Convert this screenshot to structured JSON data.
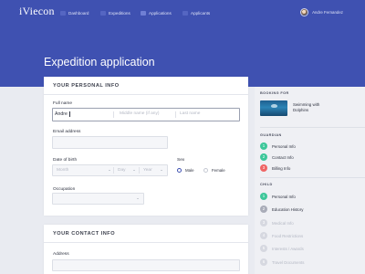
{
  "app": {
    "logo": "iViecon"
  },
  "nav": {
    "items": [
      {
        "label": "Dashboard"
      },
      {
        "label": "Expeditions"
      },
      {
        "label": "Applications"
      },
      {
        "label": "Applicants"
      }
    ],
    "user_name": "Andre Fernandez"
  },
  "page": {
    "title": "Expedition application"
  },
  "personal": {
    "section_title": "YOUR PERSONAL INFO",
    "fullname_label": "Full name",
    "first_value": "Andre",
    "middle_placeholder": "Middle name (if any)",
    "last_placeholder": "Last name",
    "email_label": "Email address",
    "dob_label": "Date of birth",
    "month_placeholder": "Month",
    "day_placeholder": "Day",
    "year_placeholder": "Year",
    "sex_label": "Sex",
    "male_label": "Male",
    "female_label": "Female",
    "sex_selected": "Male",
    "occupation_label": "Occupation"
  },
  "contact": {
    "section_title": "YOUR CONTACT INFO",
    "address_label": "Address"
  },
  "sidebar": {
    "booking_heading": "BOOKING FOR",
    "booking_title": "Swimming with Dolphins",
    "guardian_heading": "GUARDIAN",
    "guardian_steps": [
      {
        "num": "1",
        "label": "Personal Info",
        "status": "done"
      },
      {
        "num": "2",
        "label": "Contact Info",
        "status": "done"
      },
      {
        "num": "3",
        "label": "Billing Info",
        "status": "error"
      }
    ],
    "child_heading": "CHILD",
    "child_steps": [
      {
        "num": "1",
        "label": "Personal Info",
        "status": "done"
      },
      {
        "num": "2",
        "label": "Education History",
        "status": "current"
      },
      {
        "num": "3",
        "label": "Medical Info",
        "status": "pending"
      },
      {
        "num": "4",
        "label": "Food Restrictions",
        "status": "pending"
      },
      {
        "num": "5",
        "label": "Interests / Awards",
        "status": "pending"
      },
      {
        "num": "6",
        "label": "Travel Documents",
        "status": "pending"
      }
    ]
  },
  "colors": {
    "brand": "#3f51b1",
    "done": "#3dc79a",
    "error": "#ef6565",
    "current": "#a9acb8",
    "pending": "#d6d8e0"
  }
}
